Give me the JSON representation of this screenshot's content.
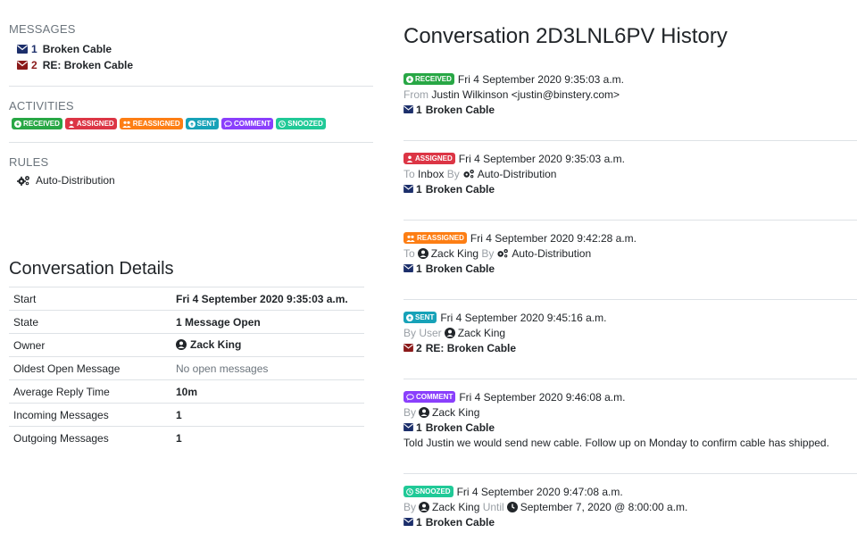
{
  "messages": {
    "title": "MESSAGES",
    "items": [
      {
        "num": "1",
        "label": "Broken Cable",
        "color": "#1c2f6b"
      },
      {
        "num": "2",
        "label": "RE: Broken Cable",
        "color": "#8b1a1a"
      }
    ]
  },
  "activities": {
    "title": "ACTIVITIES",
    "badges": [
      "RECEIVED",
      "ASSIGNED",
      "REASSIGNED",
      "SENT",
      "COMMENT",
      "SNOOZED"
    ]
  },
  "rules": {
    "title": "RULES",
    "items": [
      "Auto-Distribution"
    ]
  },
  "details": {
    "title": "Conversation Details",
    "rows": [
      {
        "key": "Start",
        "value": "Fri 4 September 2020 9:35:03 a.m."
      },
      {
        "key": "State",
        "value": "1 Message Open"
      },
      {
        "key": "Owner",
        "value": "Zack King"
      },
      {
        "key": "Oldest Open Message",
        "value": "No open messages"
      },
      {
        "key": "Average Reply Time",
        "value": "10m"
      },
      {
        "key": "Incoming Messages",
        "value": "1"
      },
      {
        "key": "Outgoing Messages",
        "value": "1"
      }
    ]
  },
  "history": {
    "title": "Conversation 2D3LNL6PV History",
    "events": [
      {
        "badge": "RECEIVED",
        "time": "Fri 4 September 2020 9:35:03 a.m.",
        "from_label": "From",
        "from_value": "Justin Wilkinson <justin@binstery.com>",
        "msg_num": "1",
        "msg_label": "Broken Cable"
      },
      {
        "badge": "ASSIGNED",
        "time": "Fri 4 September 2020 9:35:03 a.m.",
        "to_label": "To",
        "to_value": "Inbox",
        "by_label": "By",
        "by_value": "Auto-Distribution",
        "msg_num": "1",
        "msg_label": "Broken Cable"
      },
      {
        "badge": "REASSIGNED",
        "time": "Fri 4 September 2020 9:42:28 a.m.",
        "to_label": "To",
        "to_value": "Zack King",
        "by_label": "By",
        "by_value": "Auto-Distribution",
        "msg_num": "1",
        "msg_label": "Broken Cable"
      },
      {
        "badge": "SENT",
        "time": "Fri 4 September 2020 9:45:16 a.m.",
        "by_label": "By User",
        "by_value": "Zack King",
        "msg_num": "2",
        "msg_label": "RE: Broken Cable"
      },
      {
        "badge": "COMMENT",
        "time": "Fri 4 September 2020 9:46:08 a.m.",
        "by_label": "By",
        "by_value": "Zack King",
        "msg_num": "1",
        "msg_label": "Broken Cable",
        "comment": "Told Justin we would send new cable. Follow up on Monday to confirm cable has shipped."
      },
      {
        "badge": "SNOOZED",
        "time": "Fri 4 September 2020 9:47:08 a.m.",
        "by_label": "By",
        "by_value": "Zack King",
        "until_label": "Until",
        "until_value": "September 7, 2020 @ 8:00:00 a.m.",
        "msg_num": "1",
        "msg_label": "Broken Cable"
      }
    ]
  },
  "colors": {
    "received": "#28a745",
    "assigned": "#dc3545",
    "reassigned": "#fd7e14",
    "sent": "#17a2b8",
    "comment": "#8a3ffc",
    "snoozed": "#20c997",
    "navy": "#1c2f6b",
    "darkred": "#8b1a1a"
  }
}
